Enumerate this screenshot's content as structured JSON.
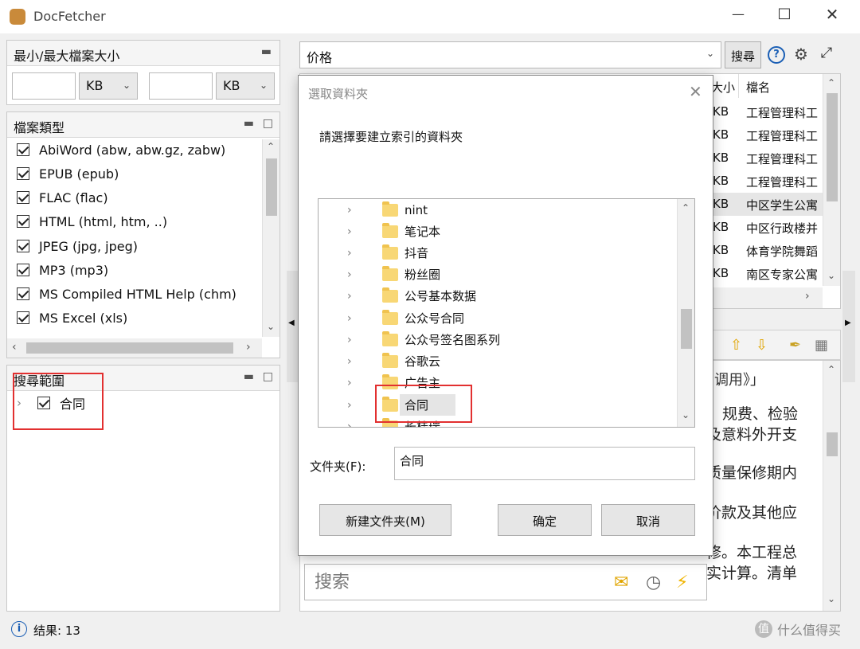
{
  "window": {
    "title": "DocFetcher"
  },
  "size_panel": {
    "title": "最小/最大檔案大小",
    "unit1": "KB",
    "unit2": "KB"
  },
  "filetype_panel": {
    "title": "檔案類型",
    "items": [
      "AbiWord (abw, abw.gz, zabw)",
      "EPUB (epub)",
      "FLAC (flac)",
      "HTML (html, htm, ..)",
      "JPEG (jpg, jpeg)",
      "MP3 (mp3)",
      "MS Compiled HTML Help (chm)",
      "MS Excel (xls)"
    ]
  },
  "scope_panel": {
    "title": "搜尋範圍",
    "items": [
      "合同"
    ]
  },
  "search_bar": {
    "query": "价格",
    "search_button": "搜尋"
  },
  "results_table": {
    "headers": {
      "size": "大小",
      "name": "檔名"
    },
    "rows": [
      {
        "size": "KB",
        "name": "工程管理科工"
      },
      {
        "size": "KB",
        "name": "工程管理科工"
      },
      {
        "size": "KB",
        "name": "工程管理科工"
      },
      {
        "size": "KB",
        "name": "工程管理科工"
      },
      {
        "size": "KB",
        "name": "中区学生公寓"
      },
      {
        "size": "KB",
        "name": "中区行政楼并"
      },
      {
        "size": "KB",
        "name": "体育学院舞蹈"
      },
      {
        "size": "KB",
        "name": "南区专家公寓"
      }
    ]
  },
  "preview": {
    "lines": [
      "规费、检验",
      "及意料外开支",
      "质量保修期内",
      "价款及其他应",
      "修。本工程总",
      "实计算。清单"
    ],
    "top_fragment": "调用》」"
  },
  "preview_search": {
    "placeholder": "搜索"
  },
  "status": {
    "result_label": "结果: 13"
  },
  "watermark": {
    "text": "什么值得买"
  },
  "dialog": {
    "title": "選取資料夾",
    "prompt": "請選擇要建立索引的資料夾",
    "folders": [
      "nint",
      "笔记本",
      "抖音",
      "粉丝圈",
      "公号基本数据",
      "公众号合同",
      "公众号签名图系列",
      "谷歌云",
      "广告主",
      "合同",
      "长桂瑞"
    ],
    "folder_label": "文件夹(F):",
    "folder_value": "合同",
    "new_folder_button": "新建文件夹(M)",
    "ok_button": "确定",
    "cancel_button": "取消"
  }
}
